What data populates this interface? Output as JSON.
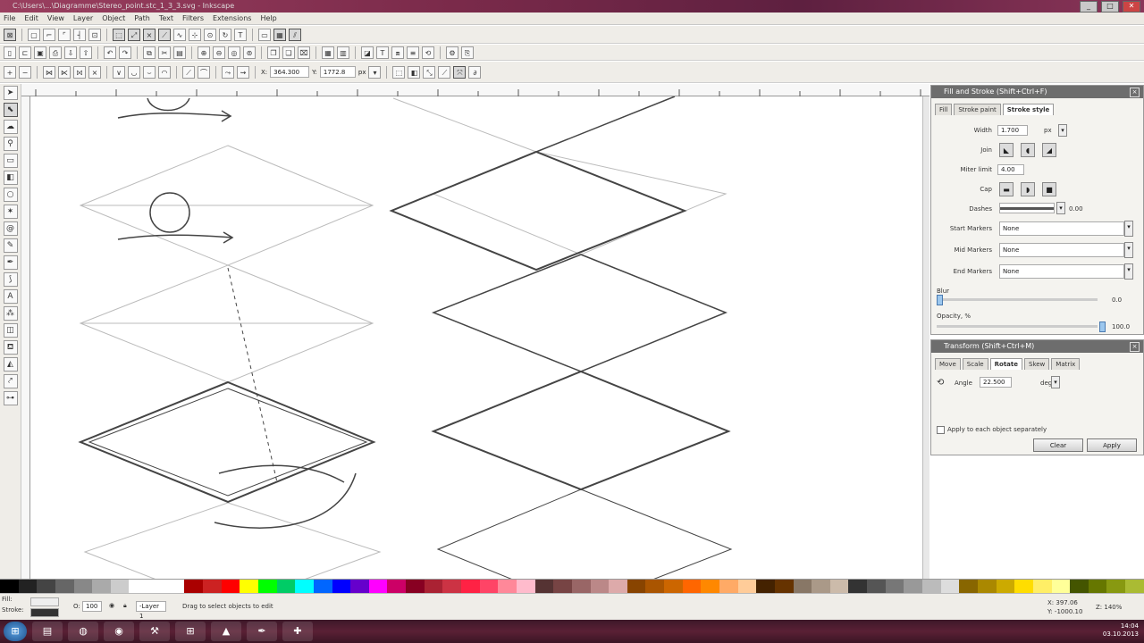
{
  "window": {
    "title": "C:\\Users\\...\\Diagramme\\Stereo_point.stc_1_3_3.svg - Inkscape",
    "controls": [
      "_",
      "□",
      "✕"
    ]
  },
  "menu": [
    "File",
    "Edit",
    "View",
    "Layer",
    "Object",
    "Path",
    "Text",
    "Filters",
    "Extensions",
    "Help"
  ],
  "toolbar3": {
    "x_value": "364.300",
    "y_value": "1772.8",
    "unit": "px"
  },
  "fill_stroke": {
    "title": "Fill and Stroke (Shift+Ctrl+F)",
    "tabs": [
      "Fill",
      "Stroke paint",
      "Stroke style"
    ],
    "width_label": "Width",
    "width_value": "1.700",
    "width_unit": "px",
    "join_label": "Join",
    "miter_label": "Miter limit",
    "miter_value": "4.00",
    "cap_label": "Cap",
    "dashes_label": "Dashes",
    "dashes_value": "0.00",
    "start_markers_label": "Start Markers",
    "start_markers_value": "None",
    "mid_markers_label": "Mid Markers",
    "mid_markers_value": "None",
    "end_markers_label": "End Markers",
    "end_markers_value": "None",
    "blur_label": "Blur",
    "blur_value": "0.0",
    "opacity_label": "Opacity, %",
    "opacity_value": "100.0"
  },
  "transform": {
    "title": "Transform (Shift+Ctrl+M)",
    "tabs": [
      "Move",
      "Scale",
      "Rotate",
      "Skew",
      "Matrix"
    ],
    "angle_label": "Angle",
    "angle_value": "22.500",
    "angle_unit": "deg",
    "apply_each_label": "Apply to each object separately",
    "clear_label": "Clear",
    "apply_label": "Apply"
  },
  "status": {
    "fill_label": "Fill:",
    "stroke_label": "Stroke:",
    "opacity_value": "100",
    "layer_label": "-Layer 1",
    "message": "Drag to select objects to edit",
    "coord_x": "X: 397.06",
    "coord_y": "Y: -1000.10",
    "zoom": "Z: 140%"
  },
  "taskbar": {
    "time": "14:04",
    "date": "03.10.2013"
  },
  "palette_colors": [
    "#000000",
    "#222222",
    "#444444",
    "#666666",
    "#888888",
    "#aaaaaa",
    "#cccccc",
    "#ffffff",
    "#ffffff",
    "#ffffff",
    "#aa0000",
    "#cc2222",
    "#ff0000",
    "#ffff00",
    "#00ff00",
    "#00cc66",
    "#00ffff",
    "#0066ff",
    "#0000ff",
    "#6600cc",
    "#ff00ff",
    "#cc0066",
    "#880022",
    "#aa2233",
    "#cc3344",
    "#ff2244",
    "#ff4466",
    "#ff8899",
    "#ffbbcc",
    "#553333",
    "#774444",
    "#996666",
    "#bb8888",
    "#ddaaaa",
    "#884400",
    "#aa5500",
    "#cc6600",
    "#ff6600",
    "#ff8800",
    "#ffaa66",
    "#ffcc99",
    "#442200",
    "#663300",
    "#887766",
    "#aa9988",
    "#ccbbaa",
    "#333333",
    "#555555",
    "#777777",
    "#999999",
    "#bbbbbb",
    "#dddddd",
    "#886600",
    "#aa8800",
    "#ccaa00",
    "#ffdd00",
    "#ffee66",
    "#ffff99",
    "#445500",
    "#667700",
    "#889911",
    "#aabb33"
  ]
}
